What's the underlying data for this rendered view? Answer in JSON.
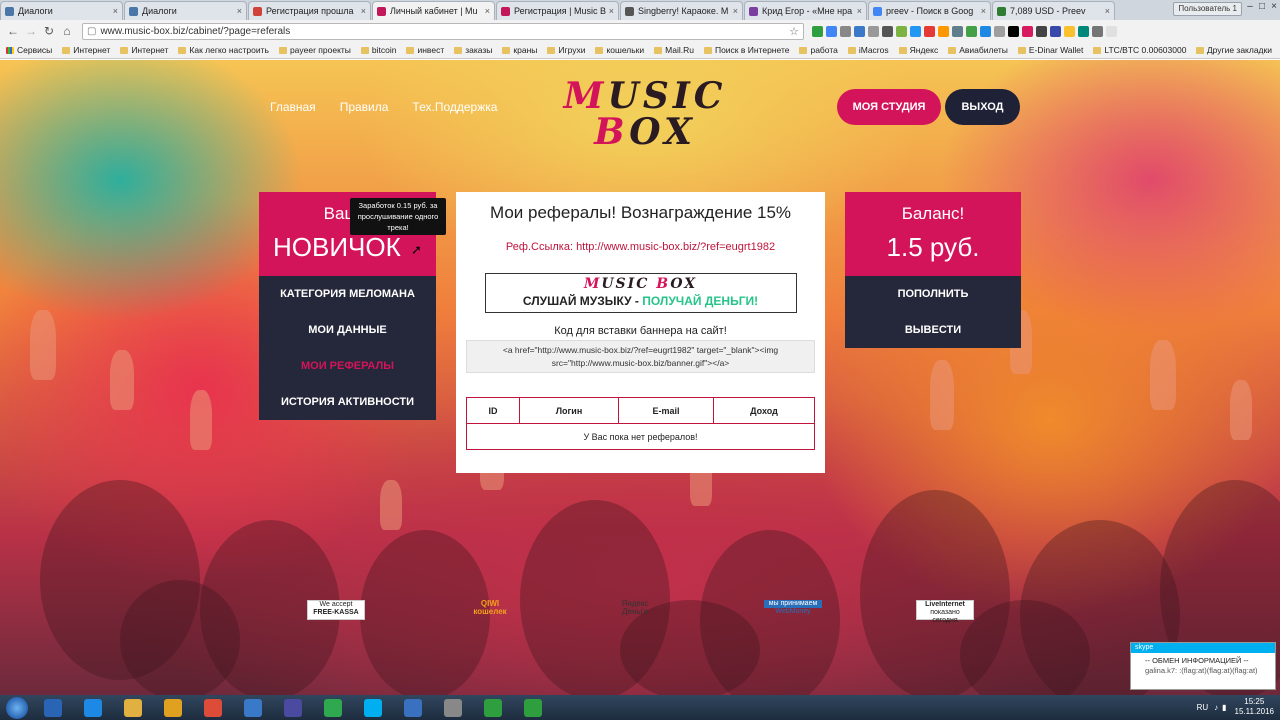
{
  "browser": {
    "tabs": [
      {
        "title": "Диалоги",
        "color": "#4a76a8",
        "active": false
      },
      {
        "title": "Диалоги",
        "color": "#4a76a8",
        "active": false
      },
      {
        "title": "Регистрация прошла",
        "color": "#d0413a",
        "active": false
      },
      {
        "title": "Личный кабинет | Mu",
        "color": "#c2185b",
        "active": true
      },
      {
        "title": "Регистрация | Music B",
        "color": "#c2185b",
        "active": false
      },
      {
        "title": "Singberry! Караоке. M",
        "color": "#555555",
        "active": false
      },
      {
        "title": "Крид Егор - «Мне нра",
        "color": "#7b3fa0",
        "active": false
      },
      {
        "title": "preev - Поиск в Goog",
        "color": "#4285f4",
        "active": false
      },
      {
        "title": "7,089 USD - Preev",
        "color": "#2e7d32",
        "active": false
      }
    ],
    "user_label": "Пользователь 1",
    "url": "www.music-box.biz/cabinet/?page=referals",
    "bookmarks": [
      "Сервисы",
      "Интернет",
      "Интернет",
      "Как легко настроить",
      "payeer проекты",
      "bitcoin",
      "инвест",
      "заказы",
      "краны",
      "Игрухи",
      "кошельки",
      "Mail.Ru",
      "Поиск в Интернете",
      "работа",
      "iMacros",
      "Яндекс",
      "Авиабилеты",
      "E-Dinar Wallet",
      "LTC/BTC 0.00603000"
    ],
    "bookmarks_more": "»",
    "other_bookmarks": "Другие закладки"
  },
  "site": {
    "nav": [
      "Главная",
      "Правила",
      "Тех.Поддержка"
    ],
    "logo_line1": {
      "cap": "M",
      "rest": "USIC"
    },
    "logo_line2": {
      "cap": "B",
      "rest": "OX"
    },
    "btn_studio": "МОЯ СТУДИЯ",
    "btn_exit": "ВЫХОД",
    "left": {
      "status_caption": "Ваш с",
      "status_value": "НОВИЧОК",
      "tooltip": "Заработок 0.15 руб. за прослушивание одного трека!",
      "menu": [
        {
          "label": "КАТЕГОРИЯ МЕЛОМАНА",
          "active": false
        },
        {
          "label": "МОИ ДАННЫЕ",
          "active": false
        },
        {
          "label": "МОИ РЕФЕРАЛЫ",
          "active": true
        },
        {
          "label": "ИСТОРИЯ АКТИВНОСТИ",
          "active": false
        }
      ]
    },
    "center": {
      "title": "Мои рефералы! Вознаграждение 15%",
      "reflink_label": "Реф.Ссылка:",
      "reflink_url": "http://www.music-box.biz/?ref=eugrt1982",
      "banner_logo": {
        "cap1": "M",
        "rest1": "USIC ",
        "cap2": "B",
        "rest2": "OX"
      },
      "banner_slogan_a": "СЛУШАЙ МУЗЫКУ - ",
      "banner_slogan_b": "ПОЛУЧАЙ ДЕНЬГИ!",
      "code_label": "Код для вставки баннера на сайт!",
      "code": "<a href=\"http://www.music-box.biz/?ref=eugrt1982\" target=\"_blank\"><img src=\"http://www.music-box.biz/banner.gif\"></a>",
      "table_headers": [
        "ID",
        "Логин",
        "E-mail",
        "Доход"
      ],
      "table_empty": "У Вас пока нет рефералов!"
    },
    "right": {
      "balance_caption": "Баланс!",
      "balance_value": "1.5 руб.",
      "menu": [
        "ПОПОЛНИТЬ",
        "ВЫВЕСТИ"
      ]
    },
    "payments": {
      "free_kassa_a": "We accept",
      "free_kassa_b": "FREE-KASSA",
      "qiwi_a": "QIWI",
      "qiwi_b": "кошелек",
      "yandex_a": "Яндекс",
      "yandex_b": "Деньги",
      "webmoney_a": "мы принимаем",
      "webmoney_b": "WebMoney",
      "liveinternet_a": "LiveInternet",
      "liveinternet_b": "показано сегодня"
    }
  },
  "skype": {
    "header": "skype",
    "msg1": "-- ОБМЕН ИНФОРМАЦИЕЙ --",
    "msg2": "galina.k7: :(flag:at)(flag:at)(flag:at)"
  },
  "taskbar": {
    "apps": [
      "#2a64b4",
      "#1e88e5",
      "#e0b040",
      "#e0a020",
      "#dd4b39",
      "#3a78c8",
      "#4a4aa0",
      "#2fa84f",
      "#00aff0",
      "#3a70c0",
      "#888888",
      "#2e9e3e",
      "#2e9e3e"
    ],
    "lang": "RU",
    "time": "15:25",
    "date": "15.11.2016"
  }
}
